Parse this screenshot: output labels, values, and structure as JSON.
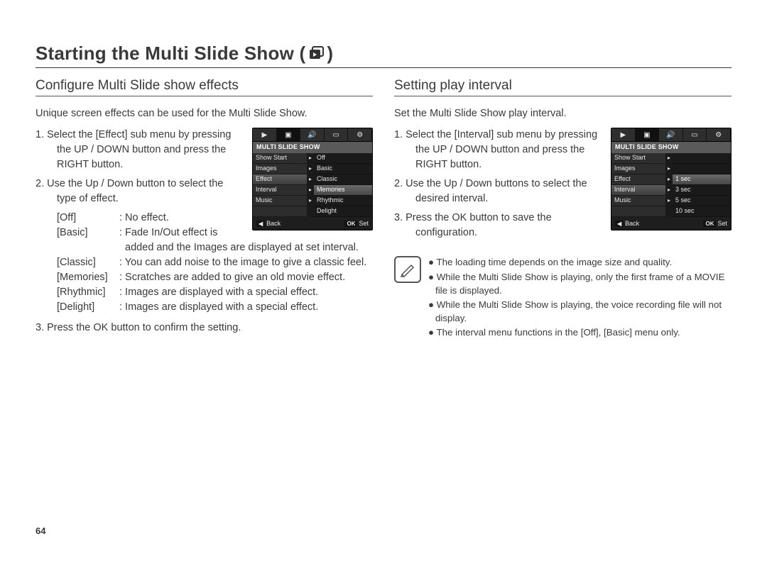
{
  "title_prefix": "Starting the Multi Slide Show ( ",
  "title_suffix": " )",
  "page_number": "64",
  "left": {
    "section_title": "Configure Multi Slide show effects",
    "intro": "Unique screen effects can be used for the Multi Slide Show.",
    "step1": "1. Select the [Effect] sub menu by pressing the UP / DOWN button and press the RIGHT button.",
    "step2": "2. Use the Up / Down button to select the type of effect.",
    "step3": "3. Press the OK button to confirm the setting.",
    "options": [
      {
        "label": "[Off]",
        "desc": ": No effect."
      },
      {
        "label": "[Basic]",
        "desc": ": Fade In/Out effect is added and the Images are displayed at set interval."
      },
      {
        "label": "[Classic]",
        "desc": ": You can add noise to the image to give a classic feel."
      },
      {
        "label": "[Memories]",
        "desc": ": Scratches are added to give an old movie effect."
      },
      {
        "label": "[Rhythmic]",
        "desc": ": Images are displayed with a special effect."
      },
      {
        "label": "[Delight]",
        "desc": ": Images are displayed with a special effect."
      }
    ],
    "lcd": {
      "header": "MULTI SLIDE SHOW",
      "rows": [
        {
          "l": "Show Start",
          "r": "Off"
        },
        {
          "l": "Images",
          "r": "Basic"
        },
        {
          "l": "Effect",
          "r": "Classic",
          "lsel": true
        },
        {
          "l": "Interval",
          "r": "Memories",
          "rsel": true
        },
        {
          "l": "Music",
          "r": "Rhythmic"
        },
        {
          "l": "",
          "r": "Delight"
        }
      ],
      "back": "Back",
      "ok": "OK",
      "set": "Set"
    }
  },
  "right": {
    "section_title": "Setting play interval",
    "intro": "Set the Multi Slide Show play interval.",
    "step1": "1. Select the [Interval] sub menu by pressing the UP / DOWN button and press the RIGHT button.",
    "step2": "2. Use the Up / Down buttons to select the desired interval.",
    "step3": "3. Press the OK button to save the configuration.",
    "lcd": {
      "header": "MULTI SLIDE SHOW",
      "rows": [
        {
          "l": "Show Start",
          "r": ""
        },
        {
          "l": "Images",
          "r": ""
        },
        {
          "l": "Effect",
          "r": "1 sec",
          "rsel": true
        },
        {
          "l": "Interval",
          "r": "3 sec",
          "lsel": true
        },
        {
          "l": "Music",
          "r": "5 sec"
        },
        {
          "l": "",
          "r": "10 sec"
        }
      ],
      "back": "Back",
      "ok": "OK",
      "set": "Set"
    },
    "notes": [
      "The loading time depends on the image size and quality.",
      "While the Multi Slide Show is playing, only the first frame of a MOVIE file is displayed.",
      "While the Multi Slide Show is playing, the voice recording file will not display.",
      "The interval menu functions in the [Off], [Basic] menu only."
    ]
  }
}
